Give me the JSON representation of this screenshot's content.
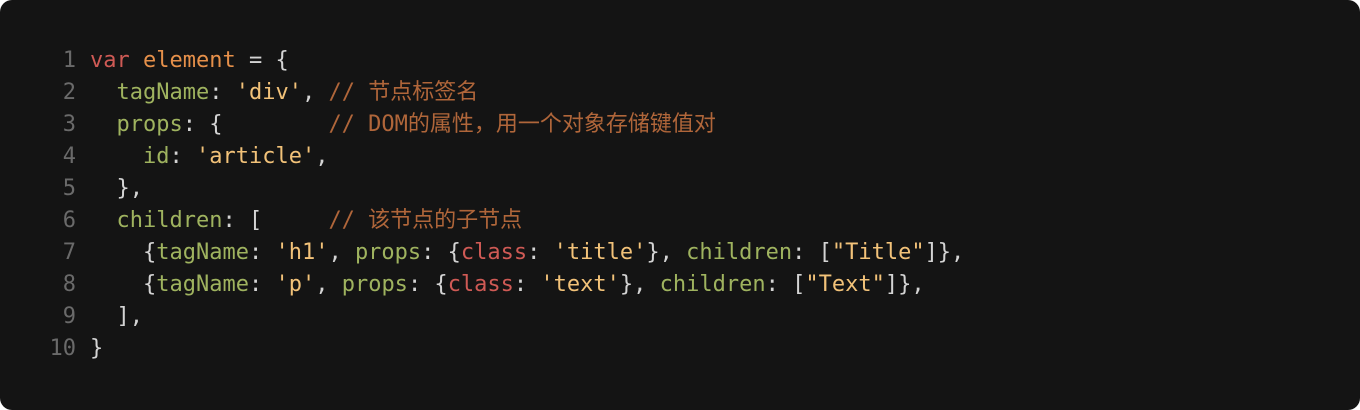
{
  "code": {
    "lines": [
      {
        "n": "1",
        "tokens": [
          {
            "t": "kw",
            "v": "var"
          },
          {
            "t": "pn",
            "v": " "
          },
          {
            "t": "vn",
            "v": "element"
          },
          {
            "t": "pn",
            "v": " = {"
          }
        ]
      },
      {
        "n": "2",
        "tokens": [
          {
            "t": "pn",
            "v": "  "
          },
          {
            "t": "pr",
            "v": "tagName"
          },
          {
            "t": "pn",
            "v": ": "
          },
          {
            "t": "st",
            "v": "'div'"
          },
          {
            "t": "pn",
            "v": ", "
          },
          {
            "t": "cm",
            "v": "// 节点标签名"
          }
        ]
      },
      {
        "n": "3",
        "tokens": [
          {
            "t": "pn",
            "v": "  "
          },
          {
            "t": "pr",
            "v": "props"
          },
          {
            "t": "pn",
            "v": ": {        "
          },
          {
            "t": "cm",
            "v": "// DOM的属性，用一个对象存储键值对"
          }
        ]
      },
      {
        "n": "4",
        "tokens": [
          {
            "t": "pn",
            "v": "    "
          },
          {
            "t": "pr",
            "v": "id"
          },
          {
            "t": "pn",
            "v": ": "
          },
          {
            "t": "st",
            "v": "'article'"
          },
          {
            "t": "pn",
            "v": ","
          }
        ]
      },
      {
        "n": "5",
        "tokens": [
          {
            "t": "pn",
            "v": "  },"
          }
        ]
      },
      {
        "n": "6",
        "tokens": [
          {
            "t": "pn",
            "v": "  "
          },
          {
            "t": "pr",
            "v": "children"
          },
          {
            "t": "pn",
            "v": ": [     "
          },
          {
            "t": "cm",
            "v": "// 该节点的子节点"
          }
        ]
      },
      {
        "n": "7",
        "tokens": [
          {
            "t": "pn",
            "v": "    {"
          },
          {
            "t": "pr",
            "v": "tagName"
          },
          {
            "t": "pn",
            "v": ": "
          },
          {
            "t": "st",
            "v": "'h1'"
          },
          {
            "t": "pn",
            "v": ", "
          },
          {
            "t": "pr",
            "v": "props"
          },
          {
            "t": "pn",
            "v": ": {"
          },
          {
            "t": "cl",
            "v": "class"
          },
          {
            "t": "pn",
            "v": ": "
          },
          {
            "t": "st",
            "v": "'title'"
          },
          {
            "t": "pn",
            "v": "}, "
          },
          {
            "t": "pr",
            "v": "children"
          },
          {
            "t": "pn",
            "v": ": ["
          },
          {
            "t": "st",
            "v": "\"Title\""
          },
          {
            "t": "pn",
            "v": "]},"
          }
        ]
      },
      {
        "n": "8",
        "tokens": [
          {
            "t": "pn",
            "v": "    {"
          },
          {
            "t": "pr",
            "v": "tagName"
          },
          {
            "t": "pn",
            "v": ": "
          },
          {
            "t": "st",
            "v": "'p'"
          },
          {
            "t": "pn",
            "v": ", "
          },
          {
            "t": "pr",
            "v": "props"
          },
          {
            "t": "pn",
            "v": ": {"
          },
          {
            "t": "cl",
            "v": "class"
          },
          {
            "t": "pn",
            "v": ": "
          },
          {
            "t": "st",
            "v": "'text'"
          },
          {
            "t": "pn",
            "v": "}, "
          },
          {
            "t": "pr",
            "v": "children"
          },
          {
            "t": "pn",
            "v": ": ["
          },
          {
            "t": "st",
            "v": "\"Text\""
          },
          {
            "t": "pn",
            "v": "]},"
          }
        ]
      },
      {
        "n": "9",
        "tokens": [
          {
            "t": "pn",
            "v": "  ],"
          }
        ]
      },
      {
        "n": "10",
        "tokens": [
          {
            "t": "pn",
            "v": "}"
          }
        ]
      }
    ]
  },
  "colors": {
    "background": "#141414",
    "line_number": "#6a6a6a",
    "keyword": "#cf5a55",
    "variable": "#e6904a",
    "property": "#9fb35f",
    "string": "#f2c279",
    "comment": "#b0663a",
    "punctuation": "#d4d4d4"
  }
}
